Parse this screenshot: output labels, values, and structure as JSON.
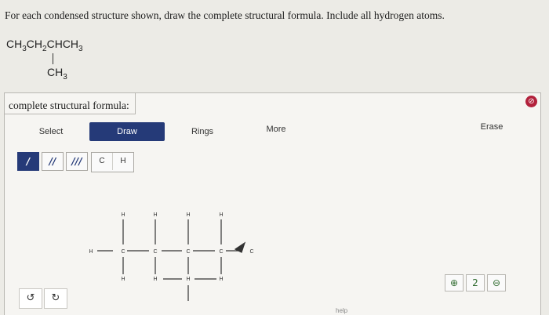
{
  "question": "For each condensed structure shown, draw the complete structural formula. Include all hydrogen atoms.",
  "condensed": {
    "main": [
      "CH",
      "3",
      "CH",
      "2",
      "CHCH",
      "3"
    ],
    "branch": [
      "CH",
      "3"
    ]
  },
  "panel": {
    "label": "complete structural formula:",
    "clear_icon": "⊘"
  },
  "toolbar": {
    "select": "Select",
    "draw": "Draw",
    "rings": "Rings",
    "more": "More",
    "erase": "Erase"
  },
  "bonds": [
    "/",
    "//",
    "///"
  ],
  "atoms": [
    "C",
    "H"
  ],
  "zoom": [
    "⊕",
    "2",
    "⊖"
  ],
  "undo": [
    "↺",
    "↻"
  ],
  "help": "help",
  "structure": {
    "atoms": [
      {
        "id": "h_l",
        "label": "H"
      },
      {
        "id": "c1",
        "label": "C"
      },
      {
        "id": "c2",
        "label": "C"
      },
      {
        "id": "c3",
        "label": "C"
      },
      {
        "id": "c4",
        "label": "C"
      },
      {
        "id": "c5",
        "label": "C"
      },
      {
        "id": "h1t",
        "label": "H"
      },
      {
        "id": "h1b",
        "label": "H"
      },
      {
        "id": "h2t",
        "label": "H"
      },
      {
        "id": "h3t",
        "label": "H"
      },
      {
        "id": "h4t",
        "label": "H"
      },
      {
        "id": "h4b",
        "label": "H"
      },
      {
        "id": "h_bl",
        "label": "H"
      },
      {
        "id": "h_br",
        "label": "H"
      }
    ]
  }
}
